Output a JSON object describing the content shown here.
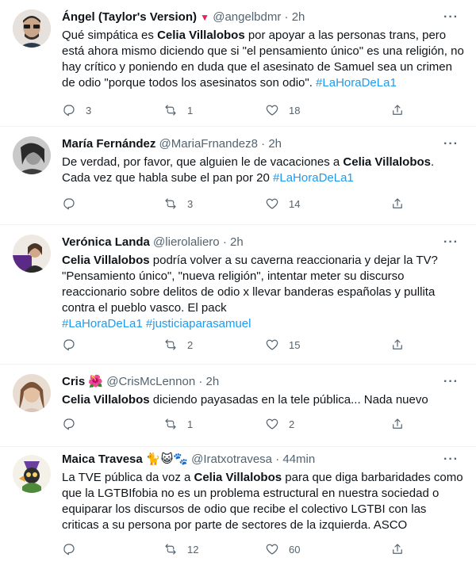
{
  "tweets": [
    {
      "name": "Ángel (Taylor's Version)",
      "name_badge": "▼",
      "handle": "@angelbdmr",
      "time": "2h",
      "p1": "Qué simpática es ",
      "p2": "Celia Villalobos",
      "p3": " por apoyar a las personas trans, pero está ahora mismo diciendo que si \"el pensamiento único\" es una religión, no hay crítico y poniendo en duda que el asesinato de Samuel sea un crimen de odio \"porque todos los asesinatos son odio\". ",
      "hashtags": "#LaHoraDeLa1",
      "replies": "3",
      "retweets": "1",
      "likes": "18"
    },
    {
      "name": "María Fernández",
      "handle": "@MariaFrnandez8",
      "time": "2h",
      "p1": "De verdad, por favor, que alguien le de vacaciones a ",
      "p2": "Celia Villalobos",
      "p3": ". Cada vez que habla sube el pan por 20 ",
      "hashtags": "#LaHoraDeLa1",
      "replies": "",
      "retweets": "3",
      "likes": "14"
    },
    {
      "name": "Verónica Landa",
      "handle": "@lierolaliero",
      "time": "2h",
      "p1": "",
      "p2": "Celia Villalobos",
      "p3": " podría volver a su caverna reaccionaria y dejar la TV? \"Pensamiento único\", \"nueva religión\", intentar meter su discurso reaccionario sobre delitos de odio x llevar banderas españolas y pullita contra el pueblo vasco. El pack",
      "hashtags": "#LaHoraDeLa1 #justiciaparasamuel",
      "replies": "",
      "retweets": "2",
      "likes": "15"
    },
    {
      "name": "Cris",
      "name_badge": "🌺",
      "handle": "@CrisMcLennon",
      "time": "2h",
      "p1": "",
      "p2": "Celia Villalobos",
      "p3": " diciendo payasadas en la tele pública... Nada nuevo",
      "hashtags": "",
      "replies": "",
      "retweets": "1",
      "likes": "2"
    },
    {
      "name": "Maica Travesa",
      "name_badge": "🐈😺🐾",
      "handle": "@Iratxotravesa",
      "time": "44min",
      "p1": "La TVE pública da voz a ",
      "p2": "Celia Villalobos",
      "p3": " para que diga barbaridades como que la LGTBIfobia no es un problema estructural en nuestra sociedad o equiparar los discursos de odio que recibe el colectivo LGTBI con las criticas a su persona por parte de sectores de la izquierda. ASCO",
      "hashtags": "",
      "replies": "",
      "retweets": "12",
      "likes": "60"
    }
  ],
  "ui": {
    "dot": "·",
    "more": "···",
    "hashtag_color": "#1d9bf0"
  }
}
